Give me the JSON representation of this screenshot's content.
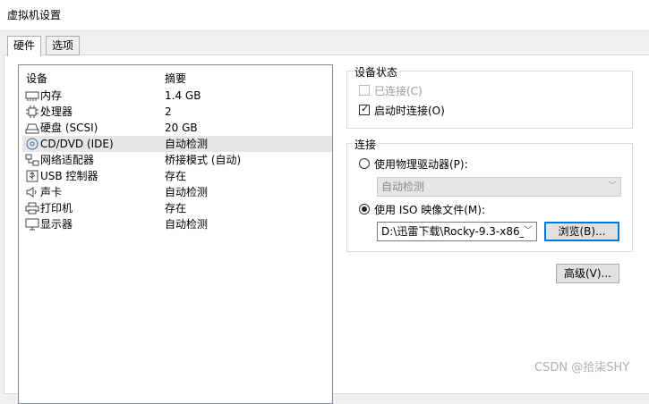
{
  "window": {
    "title": "虚拟机设置"
  },
  "tabs": [
    {
      "label": "硬件",
      "active": true
    },
    {
      "label": "选项",
      "active": false
    }
  ],
  "device_list": {
    "headers": {
      "device": "设备",
      "summary": "摘要"
    },
    "rows": [
      {
        "icon": "memory-icon",
        "name": "内存",
        "summary": "1.4 GB",
        "selected": false
      },
      {
        "icon": "processor-icon",
        "name": "处理器",
        "summary": "2",
        "selected": false
      },
      {
        "icon": "harddisk-icon",
        "name": "硬盘 (SCSI)",
        "summary": "20 GB",
        "selected": false
      },
      {
        "icon": "cd-dvd-icon",
        "name": "CD/DVD (IDE)",
        "summary": "自动检测",
        "selected": true
      },
      {
        "icon": "network-adapter-icon",
        "name": "网络适配器",
        "summary": "桥接模式 (自动)",
        "selected": false
      },
      {
        "icon": "usb-icon",
        "name": "USB 控制器",
        "summary": "存在",
        "selected": false
      },
      {
        "icon": "sound-card-icon",
        "name": "声卡",
        "summary": "自动检测",
        "selected": false
      },
      {
        "icon": "printer-icon",
        "name": "打印机",
        "summary": "存在",
        "selected": false
      },
      {
        "icon": "display-icon",
        "name": "显示器",
        "summary": "自动检测",
        "selected": false
      }
    ]
  },
  "device_status": {
    "legend": "设备状态",
    "connected": {
      "label": "已连接(C)",
      "checked": false,
      "enabled": false
    },
    "connect_at_power_on": {
      "label": "启动时连接(O)",
      "checked": true,
      "enabled": true
    }
  },
  "connection": {
    "legend": "连接",
    "physical_drive": {
      "label": "使用物理驱动器(P):",
      "selected": false,
      "value": "自动检测"
    },
    "iso_image": {
      "label": "使用 ISO 映像文件(M):",
      "selected": true,
      "value": "D:\\迅雷下载\\Rocky-9.3-x86_"
    },
    "browse_label": "浏览(B)..."
  },
  "advanced_label": "高级(V)...",
  "watermark": "CSDN @拾柒SHY"
}
